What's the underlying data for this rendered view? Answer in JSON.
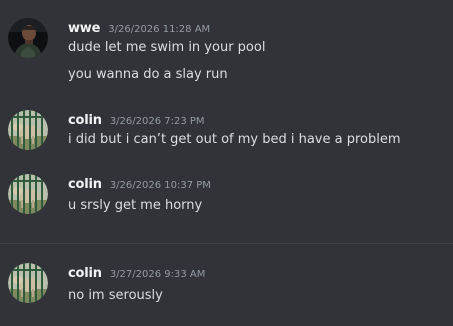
{
  "messages": [
    {
      "username": "wwe",
      "timestamp": "3/26/2026 11:28 AM",
      "avatar": "dark-photo-avatar",
      "lines": [
        "dude let me swim in your pool",
        "you wanna do a slay run"
      ]
    },
    {
      "username": "colin",
      "timestamp": "3/26/2026 7:23 PM",
      "avatar": "goat-photo-avatar",
      "lines": [
        "i did but i can’t get out of my bed i have a problem"
      ]
    },
    {
      "username": "colin",
      "timestamp": "3/26/2026 10:37 PM",
      "avatar": "goat-photo-avatar",
      "lines": [
        "u srsly get me horny"
      ]
    },
    {
      "username": "colin",
      "timestamp": "3/27/2026 9:33 AM",
      "avatar": "goat-photo-avatar",
      "lines": [
        "no im serously"
      ]
    }
  ],
  "colors": {
    "background": "#313338",
    "username": "#f2f3f5",
    "timestamp": "#949ba4",
    "message_text": "#dbdee1",
    "divider": "#3f4147"
  }
}
